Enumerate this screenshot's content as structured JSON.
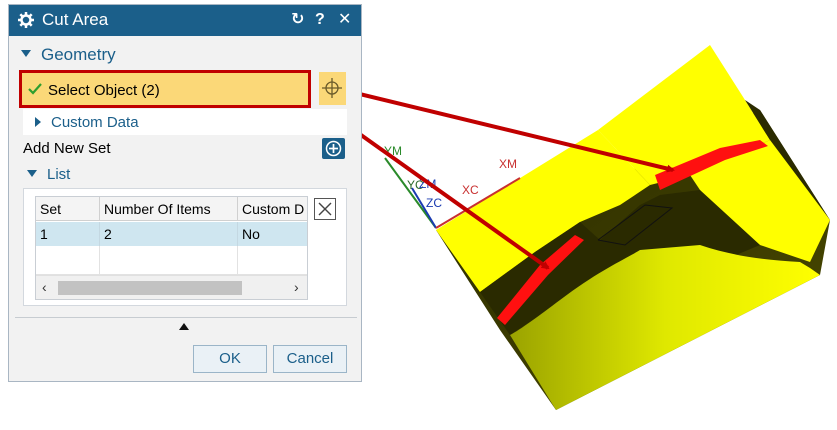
{
  "dialog": {
    "title": "Cut Area",
    "title_icon": "gear-icon",
    "controls": {
      "reset": "↻",
      "help": "?",
      "close": "✕"
    }
  },
  "geometry": {
    "header": "Geometry",
    "select_label": "Select Object (2)",
    "custom_data": "Custom Data",
    "add_new_set": "Add New Set",
    "list_header": "List"
  },
  "table": {
    "columns": [
      "Set",
      "Number Of Items",
      "Custom D"
    ],
    "rows": [
      [
        "1",
        "2",
        "No"
      ]
    ]
  },
  "footer": {
    "ok": "OK",
    "cancel": "Cancel"
  },
  "axes": {
    "ym": "YM",
    "yc": "YC",
    "zm": "ZM",
    "zc": "ZC",
    "xm": "XM",
    "xc": "XC"
  },
  "colors": {
    "accent": "#1b5f8a",
    "highlight_row": "#fbd878",
    "annotation": "#c00000",
    "part_face": "#ffff00",
    "cut_face": "#ff1010"
  }
}
